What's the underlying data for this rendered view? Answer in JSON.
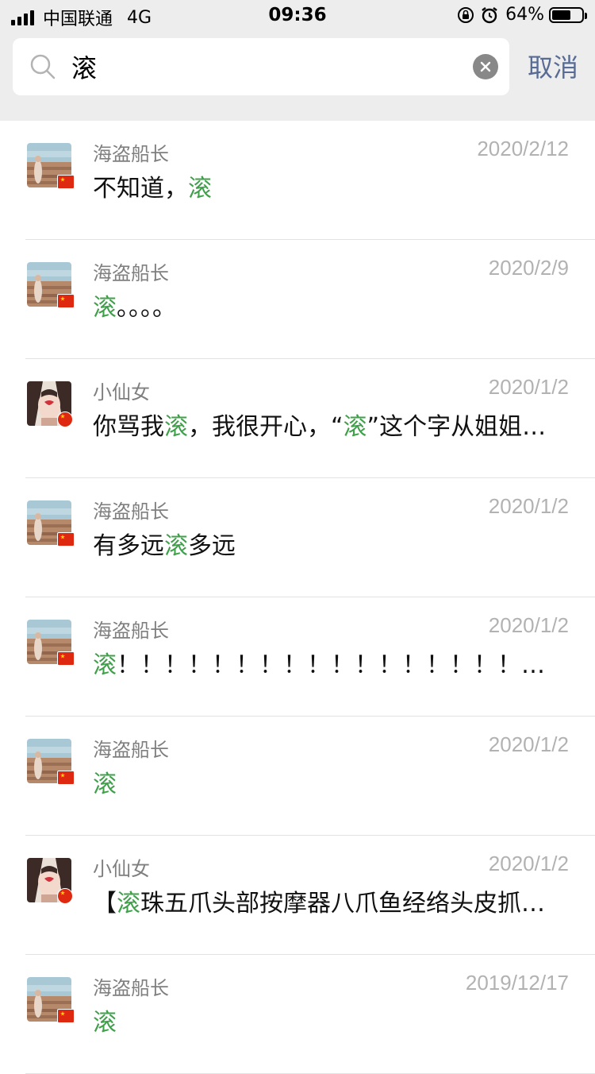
{
  "status_bar": {
    "carrier": "中国联通",
    "network": "4G",
    "time": "09:36",
    "battery_percent": "64%",
    "battery_level": 0.64
  },
  "search": {
    "query": "滚",
    "cancel_label": "取消"
  },
  "colors": {
    "highlight": "#3ea048",
    "cancel": "#576b95",
    "header_bg": "#ededed"
  },
  "results": [
    {
      "name": "海盗船长",
      "date": "2020/2/12",
      "avatar": "pirate",
      "parts": [
        "不知道，",
        "滚",
        ""
      ]
    },
    {
      "name": "海盗船长",
      "date": "2020/2/9",
      "avatar": "pirate",
      "parts": [
        "",
        "滚",
        "。。。。"
      ]
    },
    {
      "name": "小仙女",
      "date": "2020/1/2",
      "avatar": "fairy",
      "parts": [
        "你骂我",
        "滚",
        "，我很开心，“",
        "滚",
        "”这个字从姐姐…"
      ]
    },
    {
      "name": "海盗船长",
      "date": "2020/1/2",
      "avatar": "pirate",
      "parts": [
        "有多远",
        "滚",
        "多远"
      ]
    },
    {
      "name": "海盗船长",
      "date": "2020/1/2",
      "avatar": "pirate",
      "parts": [
        "",
        "滚",
        "！！！！！！！！！！！！！！！！！…"
      ]
    },
    {
      "name": "海盗船长",
      "date": "2020/1/2",
      "avatar": "pirate",
      "parts": [
        "",
        "滚",
        ""
      ]
    },
    {
      "name": "小仙女",
      "date": "2020/1/2",
      "avatar": "fairy",
      "parts": [
        "【",
        "滚",
        "珠五爪头部按摩器八爪鱼经络头皮抓…"
      ]
    },
    {
      "name": "海盗船长",
      "date": "2019/12/17",
      "avatar": "pirate",
      "parts": [
        "",
        "滚",
        ""
      ]
    }
  ]
}
